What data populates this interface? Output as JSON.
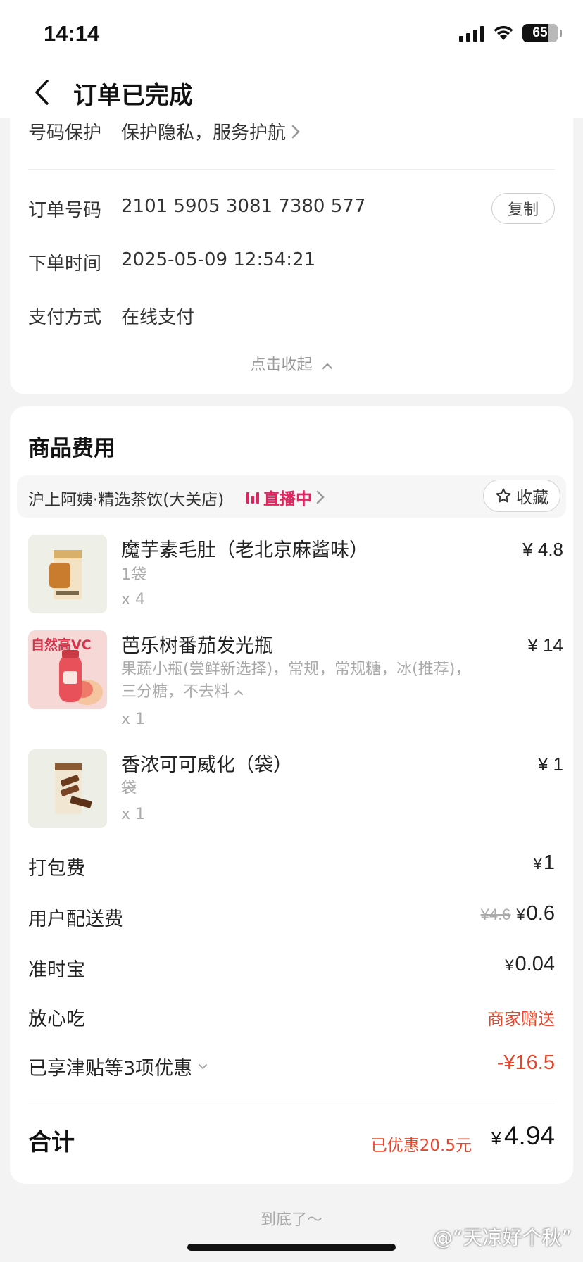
{
  "status_bar": {
    "time": "14:14",
    "battery": "65"
  },
  "header": {
    "title": "订单已完成"
  },
  "order_info": {
    "privacy_label": "号码保护",
    "privacy_value": "保护隐私，服务护航",
    "order_no_label": "订单号码",
    "order_no_value": "2101 5905 3081 7380 577",
    "copy_label": "复制",
    "time_label": "下单时间",
    "time_value": "2025-05-09 12:54:21",
    "pay_label": "支付方式",
    "pay_value": "在线支付",
    "collapse_label": "点击收起"
  },
  "fees_section": {
    "title": "商品费用",
    "store_name": "沪上阿姨·精选茶饮(大关店)",
    "live_label": "直播中",
    "favorite_label": "收藏"
  },
  "products": [
    {
      "name": "魔芋素毛肚（老北京麻酱味）",
      "spec": "1袋",
      "spec2": "",
      "qty": "x 4",
      "price": "¥ 4.8"
    },
    {
      "name": "芭乐树番茄发光瓶",
      "spec": "果蔬小瓶(尝鲜新选择)，常规，常规糖，冰(推荐)，",
      "spec2": "三分糖，不去料",
      "qty": "x 1",
      "price": "¥ 14",
      "thumb_text": "自然高VC"
    },
    {
      "name": "香浓可可威化（袋）",
      "spec": "袋",
      "spec2": "",
      "qty": "x 1",
      "price": "¥ 1"
    }
  ],
  "fees": {
    "packing_label": "打包费",
    "packing_value": "1",
    "delivery_label": "用户配送费",
    "delivery_original": "¥4.6",
    "delivery_value": "0.6",
    "ontime_label": "准时宝",
    "ontime_value": "0.04",
    "safe_label": "放心吃",
    "safe_value": "商家赠送",
    "discount_label": "已享津贴等3项优惠",
    "discount_value": "-¥16.5",
    "yen": "¥"
  },
  "total": {
    "label": "合计",
    "saved": "已优惠20.5元",
    "value": "4.94"
  },
  "footer": {
    "end_text": "到底了～",
    "watermark": "@“天凉好个秋”"
  },
  "colors": {
    "accent_red": "#e8452c",
    "live_pink": "#e0245e",
    "background": "#f3f3f3"
  }
}
